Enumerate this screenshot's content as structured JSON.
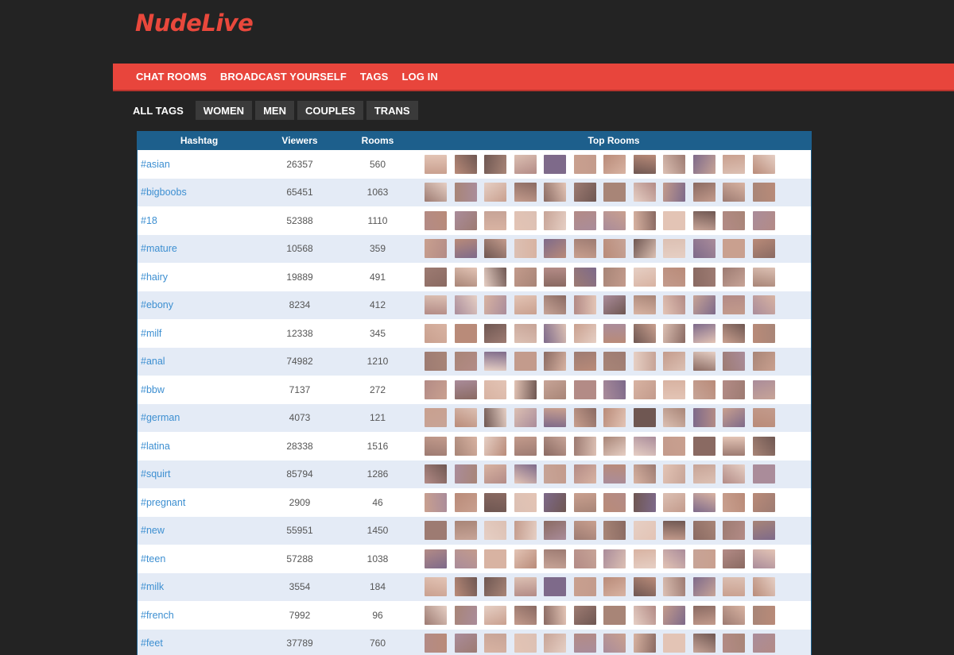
{
  "site": {
    "logo": "NudeLive"
  },
  "nav": [
    "CHAT ROOMS",
    "BROADCAST YOURSELF",
    "TAGS",
    "LOG IN"
  ],
  "tabs": [
    "ALL TAGS",
    "WOMEN",
    "MEN",
    "COUPLES",
    "TRANS"
  ],
  "active_tab": "ALL TAGS",
  "table": {
    "headers": {
      "hashtag": "Hashtag",
      "viewers": "Viewers",
      "rooms": "Rooms",
      "top_rooms": "Top Rooms"
    },
    "thumbs_per_row": 12,
    "rows": [
      {
        "tag": "#asian",
        "viewers": "26357",
        "rooms": "560"
      },
      {
        "tag": "#bigboobs",
        "viewers": "65451",
        "rooms": "1063"
      },
      {
        "tag": "#18",
        "viewers": "52388",
        "rooms": "1110"
      },
      {
        "tag": "#mature",
        "viewers": "10568",
        "rooms": "359"
      },
      {
        "tag": "#hairy",
        "viewers": "19889",
        "rooms": "491"
      },
      {
        "tag": "#ebony",
        "viewers": "8234",
        "rooms": "412"
      },
      {
        "tag": "#milf",
        "viewers": "12338",
        "rooms": "345"
      },
      {
        "tag": "#anal",
        "viewers": "74982",
        "rooms": "1210"
      },
      {
        "tag": "#bbw",
        "viewers": "7137",
        "rooms": "272"
      },
      {
        "tag": "#german",
        "viewers": "4073",
        "rooms": "121"
      },
      {
        "tag": "#latina",
        "viewers": "28338",
        "rooms": "1516"
      },
      {
        "tag": "#squirt",
        "viewers": "85794",
        "rooms": "1286"
      },
      {
        "tag": "#pregnant",
        "viewers": "2909",
        "rooms": "46"
      },
      {
        "tag": "#new",
        "viewers": "55951",
        "rooms": "1450"
      },
      {
        "tag": "#teen",
        "viewers": "57288",
        "rooms": "1038"
      },
      {
        "tag": "#milk",
        "viewers": "3554",
        "rooms": "184"
      },
      {
        "tag": "#french",
        "viewers": "7992",
        "rooms": "96"
      },
      {
        "tag": "#feet",
        "viewers": "37789",
        "rooms": "760"
      }
    ]
  },
  "colors": {
    "background": "#232323",
    "accent": "#e8453c",
    "header_blue": "#1d5f8c",
    "link": "#3d8fd1",
    "row_alt": "#e4ebf6"
  }
}
